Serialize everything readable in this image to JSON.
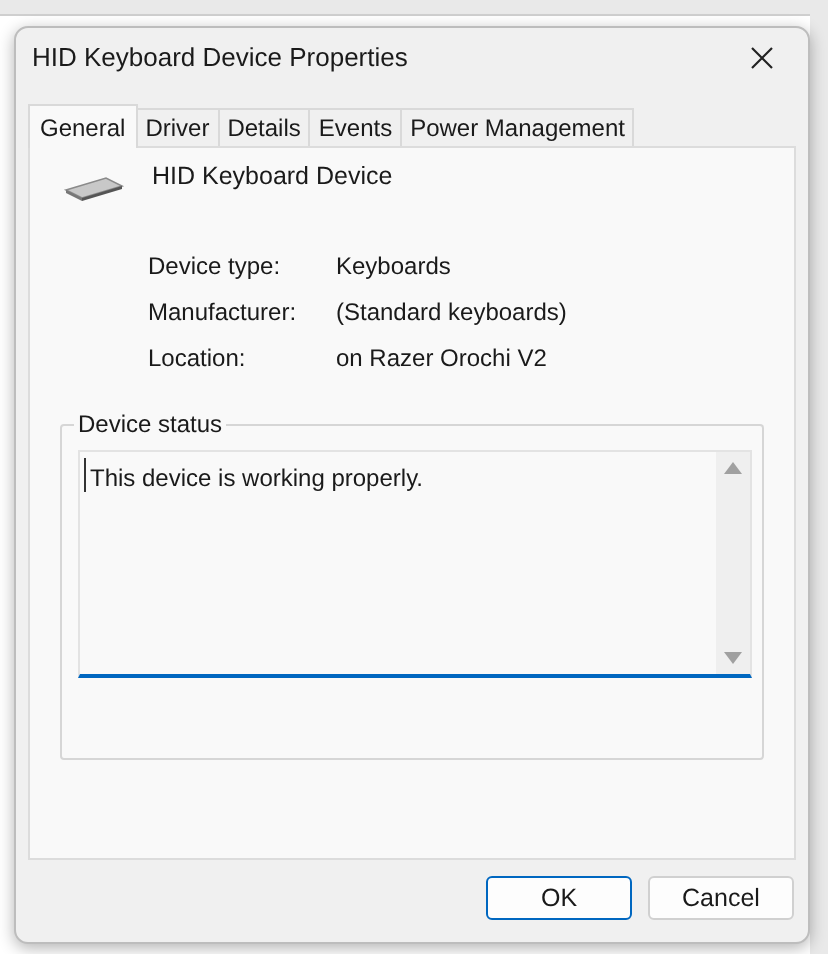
{
  "window": {
    "title": "HID Keyboard Device Properties"
  },
  "tabs": [
    {
      "label": "General",
      "selected": true
    },
    {
      "label": "Driver",
      "selected": false
    },
    {
      "label": "Details",
      "selected": false
    },
    {
      "label": "Events",
      "selected": false
    },
    {
      "label": "Power Management",
      "selected": false
    }
  ],
  "device": {
    "name": "HID Keyboard Device"
  },
  "properties": [
    {
      "label": "Device type:",
      "value": "Keyboards"
    },
    {
      "label": "Manufacturer:",
      "value": "(Standard keyboards)"
    },
    {
      "label": "Location:",
      "value": "on Razer Orochi V2"
    }
  ],
  "device_status": {
    "title": "Device status",
    "text": "This device is working properly."
  },
  "buttons": [
    {
      "label": "OK",
      "default": true
    },
    {
      "label": "Cancel",
      "default": false
    }
  ]
}
